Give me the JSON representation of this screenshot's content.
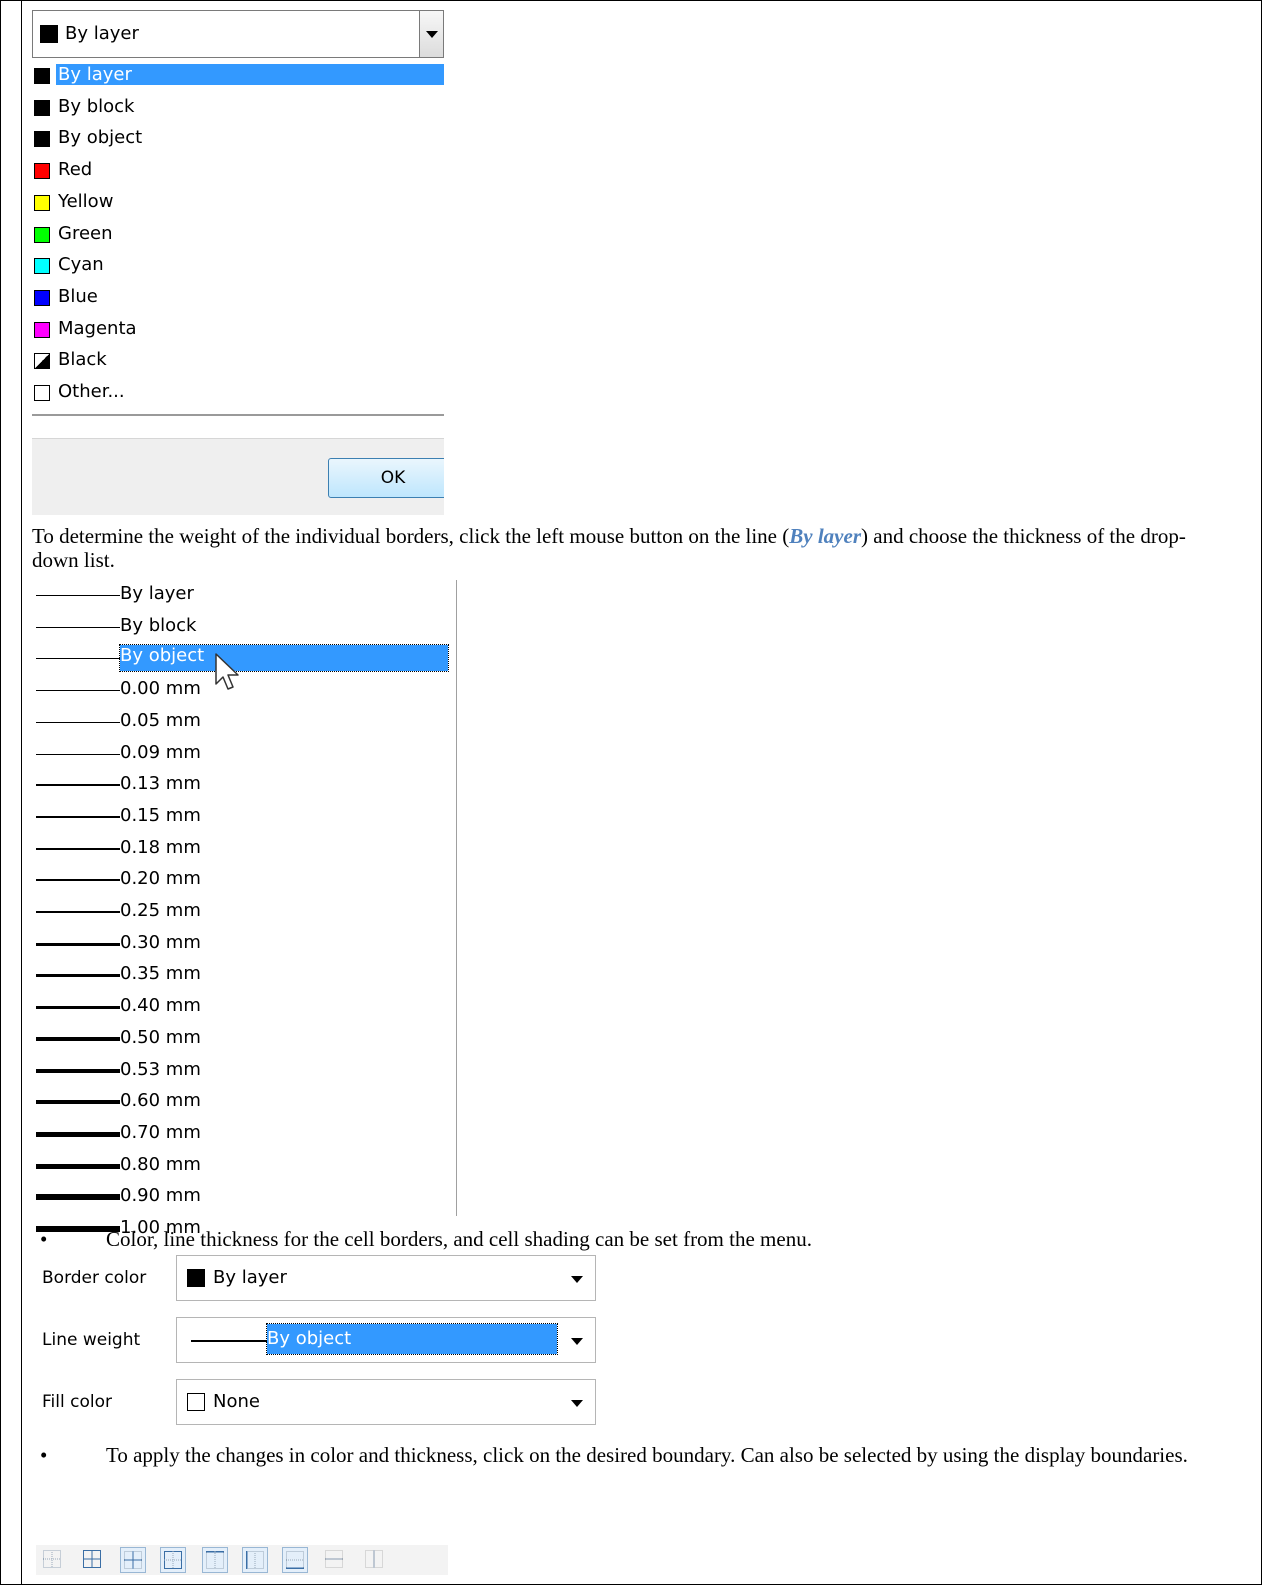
{
  "color_combo": {
    "value": "By layer",
    "swatch": "#000000"
  },
  "color_list": [
    {
      "label": "By layer",
      "color": "#000000",
      "selected": true
    },
    {
      "label": "By block",
      "color": "#000000"
    },
    {
      "label": "By object",
      "color": "#000000"
    },
    {
      "label": "Red",
      "color": "#ff0000"
    },
    {
      "label": "Yellow",
      "color": "#ffff00"
    },
    {
      "label": "Green",
      "color": "#00ff00"
    },
    {
      "label": "Cyan",
      "color": "#00ffff"
    },
    {
      "label": "Blue",
      "color": "#0000ff"
    },
    {
      "label": "Magenta",
      "color": "#ff00ff"
    },
    {
      "label": "Black",
      "color": "half"
    },
    {
      "label": "Other...",
      "color": "#ffffff"
    }
  ],
  "ok_button": "OK",
  "para1": {
    "before": "To determine the weight of the individual borders, click the left mouse button on the line (",
    "emph": "By layer",
    "after": ") and choose the thickness of the drop-down list."
  },
  "lineweights": [
    {
      "label": "By layer",
      "thickness_mm": 0
    },
    {
      "label": "By block",
      "thickness_mm": 0
    },
    {
      "label": "By object",
      "thickness_mm": 0,
      "selected": true
    },
    {
      "label": "0.00 mm",
      "thickness_mm": 0
    },
    {
      "label": "0.05 mm",
      "thickness_mm": 0.05
    },
    {
      "label": "0.09 mm",
      "thickness_mm": 0.09
    },
    {
      "label": "0.13 mm",
      "thickness_mm": 0.13
    },
    {
      "label": "0.15 mm",
      "thickness_mm": 0.15
    },
    {
      "label": "0.18 mm",
      "thickness_mm": 0.18
    },
    {
      "label": "0.20 mm",
      "thickness_mm": 0.2
    },
    {
      "label": "0.25 mm",
      "thickness_mm": 0.25
    },
    {
      "label": "0.30 mm",
      "thickness_mm": 0.3
    },
    {
      "label": "0.35 mm",
      "thickness_mm": 0.35
    },
    {
      "label": "0.40 mm",
      "thickness_mm": 0.4
    },
    {
      "label": "0.50 mm",
      "thickness_mm": 0.5
    },
    {
      "label": "0.53 mm",
      "thickness_mm": 0.53
    },
    {
      "label": "0.60 mm",
      "thickness_mm": 0.6
    },
    {
      "label": "0.70 mm",
      "thickness_mm": 0.7
    },
    {
      "label": "0.80 mm",
      "thickness_mm": 0.8
    },
    {
      "label": "0.90 mm",
      "thickness_mm": 0.9
    },
    {
      "label": "1.00 mm",
      "thickness_mm": 1.0
    }
  ],
  "bullet1": "Color, line thickness for the cell borders, and cell shading can be set from the menu.",
  "bullet_char": "•",
  "properties": {
    "border_color": {
      "label": "Border color",
      "value": "By layer",
      "swatch": "#000000"
    },
    "line_weight": {
      "label": "Line weight",
      "value": "By object"
    },
    "fill_color": {
      "label": "Fill color",
      "value": "None",
      "swatch": "#ffffff"
    }
  },
  "bullet2": "To apply the changes in color and thickness, click on the desired boundary. Can also be selected by using the display boundaries.",
  "toolbar_buttons": [
    {
      "icon": "no-borders-icon",
      "active": false
    },
    {
      "icon": "all-borders-icon",
      "active": false
    },
    {
      "icon": "inside-borders-icon",
      "active": true
    },
    {
      "icon": "outside-borders-icon",
      "active": true
    },
    {
      "icon": "top-border-icon",
      "active": true
    },
    {
      "icon": "left-border-icon",
      "active": true
    },
    {
      "icon": "bottom-border-icon",
      "active": true
    },
    {
      "icon": "inside-horizontal-border-icon",
      "active": false
    },
    {
      "icon": "inside-vertical-border-icon",
      "active": false
    }
  ]
}
